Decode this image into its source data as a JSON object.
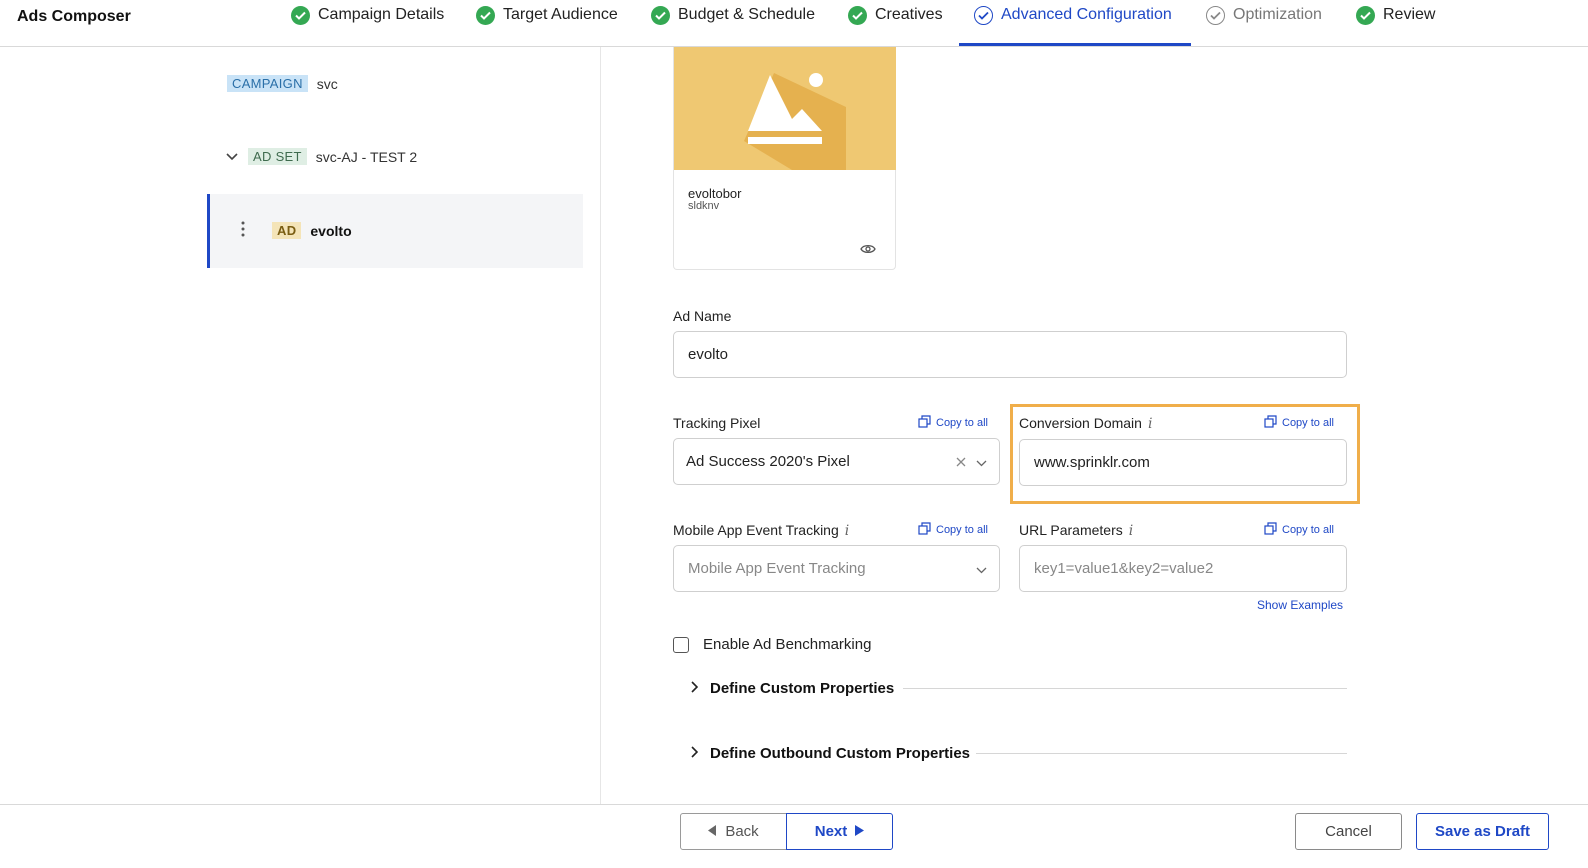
{
  "app": {
    "title": "Ads Composer"
  },
  "steps": [
    {
      "label": "Campaign Details",
      "status": "done"
    },
    {
      "label": "Target Audience",
      "status": "done"
    },
    {
      "label": "Budget & Schedule",
      "status": "done"
    },
    {
      "label": "Creatives",
      "status": "done"
    },
    {
      "label": "Advanced Configuration",
      "status": "active"
    },
    {
      "label": "Optimization",
      "status": "pending"
    },
    {
      "label": "Review",
      "status": "done"
    }
  ],
  "tree": {
    "campaign": {
      "tag": "CAMPAIGN",
      "name": "svc"
    },
    "adset": {
      "tag": "AD SET",
      "name": "svc-AJ - TEST 2"
    },
    "ad": {
      "tag": "AD",
      "name": "evolto"
    }
  },
  "preview": {
    "title": "evoltobor",
    "subtitle": "sldknv"
  },
  "form": {
    "ad_name": {
      "label": "Ad Name",
      "value": "evolto"
    },
    "tracking_pixel": {
      "label": "Tracking Pixel",
      "value": "Ad Success 2020's Pixel",
      "copy": "Copy to all"
    },
    "conversion_domain": {
      "label": "Conversion Domain",
      "value": "www.sprinklr.com",
      "copy": "Copy to all",
      "info": "i"
    },
    "mobile_app": {
      "label": "Mobile App Event Tracking",
      "placeholder": "Mobile App Event Tracking",
      "copy": "Copy to all",
      "info": "i"
    },
    "url_params": {
      "label": "URL Parameters",
      "placeholder": "key1=value1&key2=value2",
      "copy": "Copy to all",
      "info": "i",
      "examples": "Show Examples"
    },
    "benchmarking": {
      "label": "Enable Ad Benchmarking",
      "checked": false
    },
    "custom_properties": "Define Custom Properties",
    "outbound_properties": "Define Outbound Custom Properties"
  },
  "footer": {
    "back": "Back",
    "next": "Next",
    "cancel": "Cancel",
    "save_draft": "Save as Draft"
  },
  "colors": {
    "accent": "#1f48c6",
    "success": "#34a853",
    "highlight": "#f0ae4a"
  }
}
